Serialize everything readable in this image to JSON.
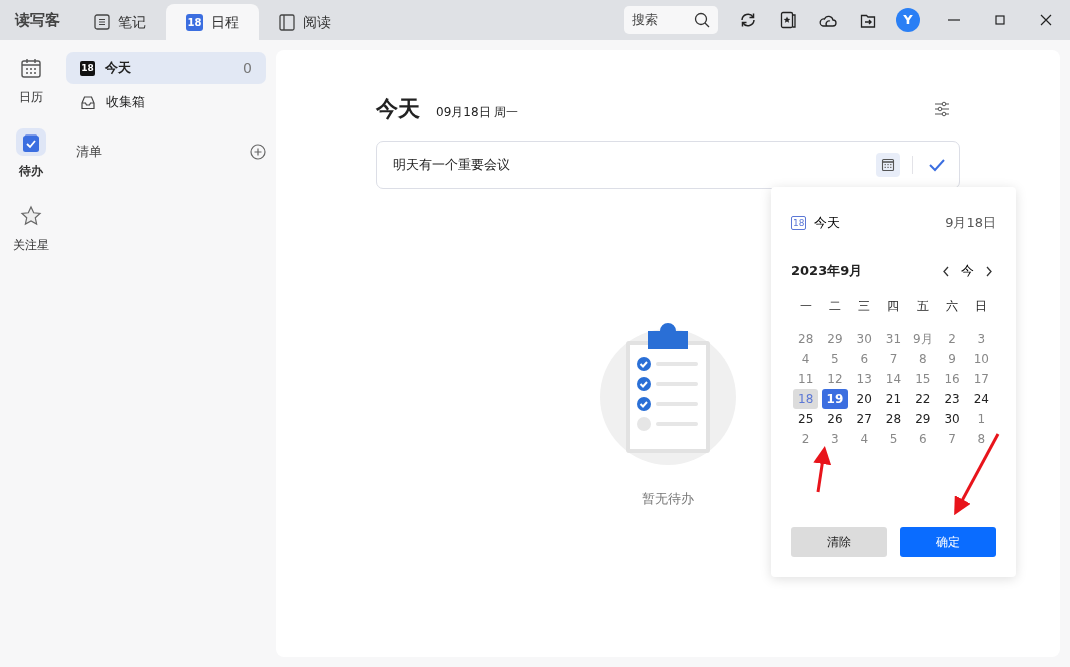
{
  "app": {
    "title": "读写客"
  },
  "tabs": [
    {
      "label": "笔记",
      "selected": false
    },
    {
      "label": "日程",
      "badge": "18",
      "selected": true
    },
    {
      "label": "阅读",
      "selected": false
    }
  ],
  "search": {
    "placeholder": "搜索"
  },
  "avatar": {
    "initial": "Y"
  },
  "rail": [
    {
      "label": "日历",
      "selected": false
    },
    {
      "label": "待办",
      "selected": true
    },
    {
      "label": "关注星",
      "selected": false
    }
  ],
  "sidebar": {
    "items": [
      {
        "label": "今天",
        "badge": "18",
        "count": "0",
        "selected": true
      },
      {
        "label": "收集箱",
        "selected": false
      }
    ],
    "section": "清单"
  },
  "main": {
    "title": "今天",
    "date": "09月18日 周一",
    "task_input": {
      "value": "明天有一个重要会议"
    },
    "empty_text": "暂无待办"
  },
  "picker": {
    "today_label": "今天",
    "today_icon": "18",
    "today_date": "9月18日",
    "month": "2023年9月",
    "today_button": "今",
    "weekdays": [
      "一",
      "二",
      "三",
      "四",
      "五",
      "六",
      "日"
    ],
    "days": [
      {
        "label": "28",
        "dim": true,
        "today": false,
        "selected": false
      },
      {
        "label": "29",
        "dim": true,
        "today": false,
        "selected": false
      },
      {
        "label": "30",
        "dim": true,
        "today": false,
        "selected": false
      },
      {
        "label": "31",
        "dim": true,
        "today": false,
        "selected": false
      },
      {
        "label": "9月",
        "dim": true,
        "today": false,
        "selected": false
      },
      {
        "label": "2",
        "dim": true,
        "today": false,
        "selected": false
      },
      {
        "label": "3",
        "dim": true,
        "today": false,
        "selected": false
      },
      {
        "label": "4",
        "dim": true,
        "today": false,
        "selected": false
      },
      {
        "label": "5",
        "dim": true,
        "today": false,
        "selected": false
      },
      {
        "label": "6",
        "dim": true,
        "today": false,
        "selected": false
      },
      {
        "label": "7",
        "dim": true,
        "today": false,
        "selected": false
      },
      {
        "label": "8",
        "dim": true,
        "today": false,
        "selected": false
      },
      {
        "label": "9",
        "dim": true,
        "today": false,
        "selected": false
      },
      {
        "label": "10",
        "dim": true,
        "today": false,
        "selected": false
      },
      {
        "label": "11",
        "dim": true,
        "today": false,
        "selected": false
      },
      {
        "label": "12",
        "dim": true,
        "today": false,
        "selected": false
      },
      {
        "label": "13",
        "dim": true,
        "today": false,
        "selected": false
      },
      {
        "label": "14",
        "dim": true,
        "today": false,
        "selected": false
      },
      {
        "label": "15",
        "dim": true,
        "today": false,
        "selected": false
      },
      {
        "label": "16",
        "dim": true,
        "today": false,
        "selected": false
      },
      {
        "label": "17",
        "dim": true,
        "today": false,
        "selected": false
      },
      {
        "label": "18",
        "dim": false,
        "today": true,
        "selected": false
      },
      {
        "label": "19",
        "dim": false,
        "today": false,
        "selected": true
      },
      {
        "label": "20",
        "dim": false,
        "today": false,
        "selected": false
      },
      {
        "label": "21",
        "dim": false,
        "today": false,
        "selected": false
      },
      {
        "label": "22",
        "dim": false,
        "today": false,
        "selected": false
      },
      {
        "label": "23",
        "dim": false,
        "today": false,
        "selected": false
      },
      {
        "label": "24",
        "dim": false,
        "today": false,
        "selected": false
      },
      {
        "label": "25",
        "dim": false,
        "today": false,
        "selected": false
      },
      {
        "label": "26",
        "dim": false,
        "today": false,
        "selected": false
      },
      {
        "label": "27",
        "dim": false,
        "today": false,
        "selected": false
      },
      {
        "label": "28",
        "dim": false,
        "today": false,
        "selected": false
      },
      {
        "label": "29",
        "dim": false,
        "today": false,
        "selected": false
      },
      {
        "label": "30",
        "dim": false,
        "today": false,
        "selected": false
      },
      {
        "label": "1",
        "dim": true,
        "today": false,
        "selected": false
      },
      {
        "label": "2",
        "dim": true,
        "today": false,
        "selected": false
      },
      {
        "label": "3",
        "dim": true,
        "today": false,
        "selected": false
      },
      {
        "label": "4",
        "dim": true,
        "today": false,
        "selected": false
      },
      {
        "label": "5",
        "dim": true,
        "today": false,
        "selected": false
      },
      {
        "label": "6",
        "dim": true,
        "today": false,
        "selected": false
      },
      {
        "label": "7",
        "dim": true,
        "today": false,
        "selected": false
      },
      {
        "label": "8",
        "dim": true,
        "today": false,
        "selected": false
      }
    ],
    "buttons": [
      {
        "label": "清除",
        "kind": "secondary"
      },
      {
        "label": "确定",
        "kind": "primary"
      }
    ]
  }
}
